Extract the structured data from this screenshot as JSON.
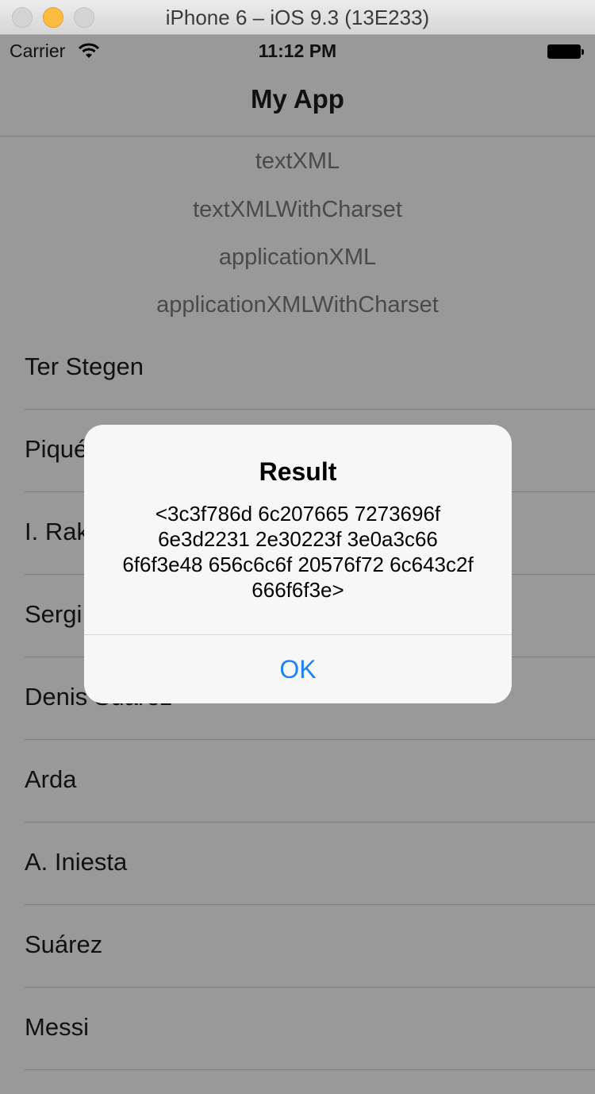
{
  "window": {
    "title": "iPhone 6 – iOS 9.3 (13E233)"
  },
  "status_bar": {
    "carrier": "Carrier",
    "time": "11:12 PM"
  },
  "nav": {
    "title": "My App"
  },
  "content_types": [
    "textXML",
    "textXMLWithCharset",
    "applicationXML",
    "applicationXMLWithCharset"
  ],
  "players": [
    "Ter Stegen",
    "Piqué",
    "I. Rakitic",
    "Sergi Roberto",
    "Denis Suárez",
    "Arda",
    "A. Iniesta",
    "Suárez",
    "Messi"
  ],
  "alert": {
    "title": "Result",
    "message": "<3c3f786d 6c207665 7273696f 6e3d2231 2e30223f 3e0a3c66 6f6f3e48 656c6c6f 20576f72 6c643c2f 666f6f3e>",
    "ok_label": "OK"
  },
  "colors": {
    "tint": "#1a82fb",
    "dimmed_background": "#999999"
  }
}
